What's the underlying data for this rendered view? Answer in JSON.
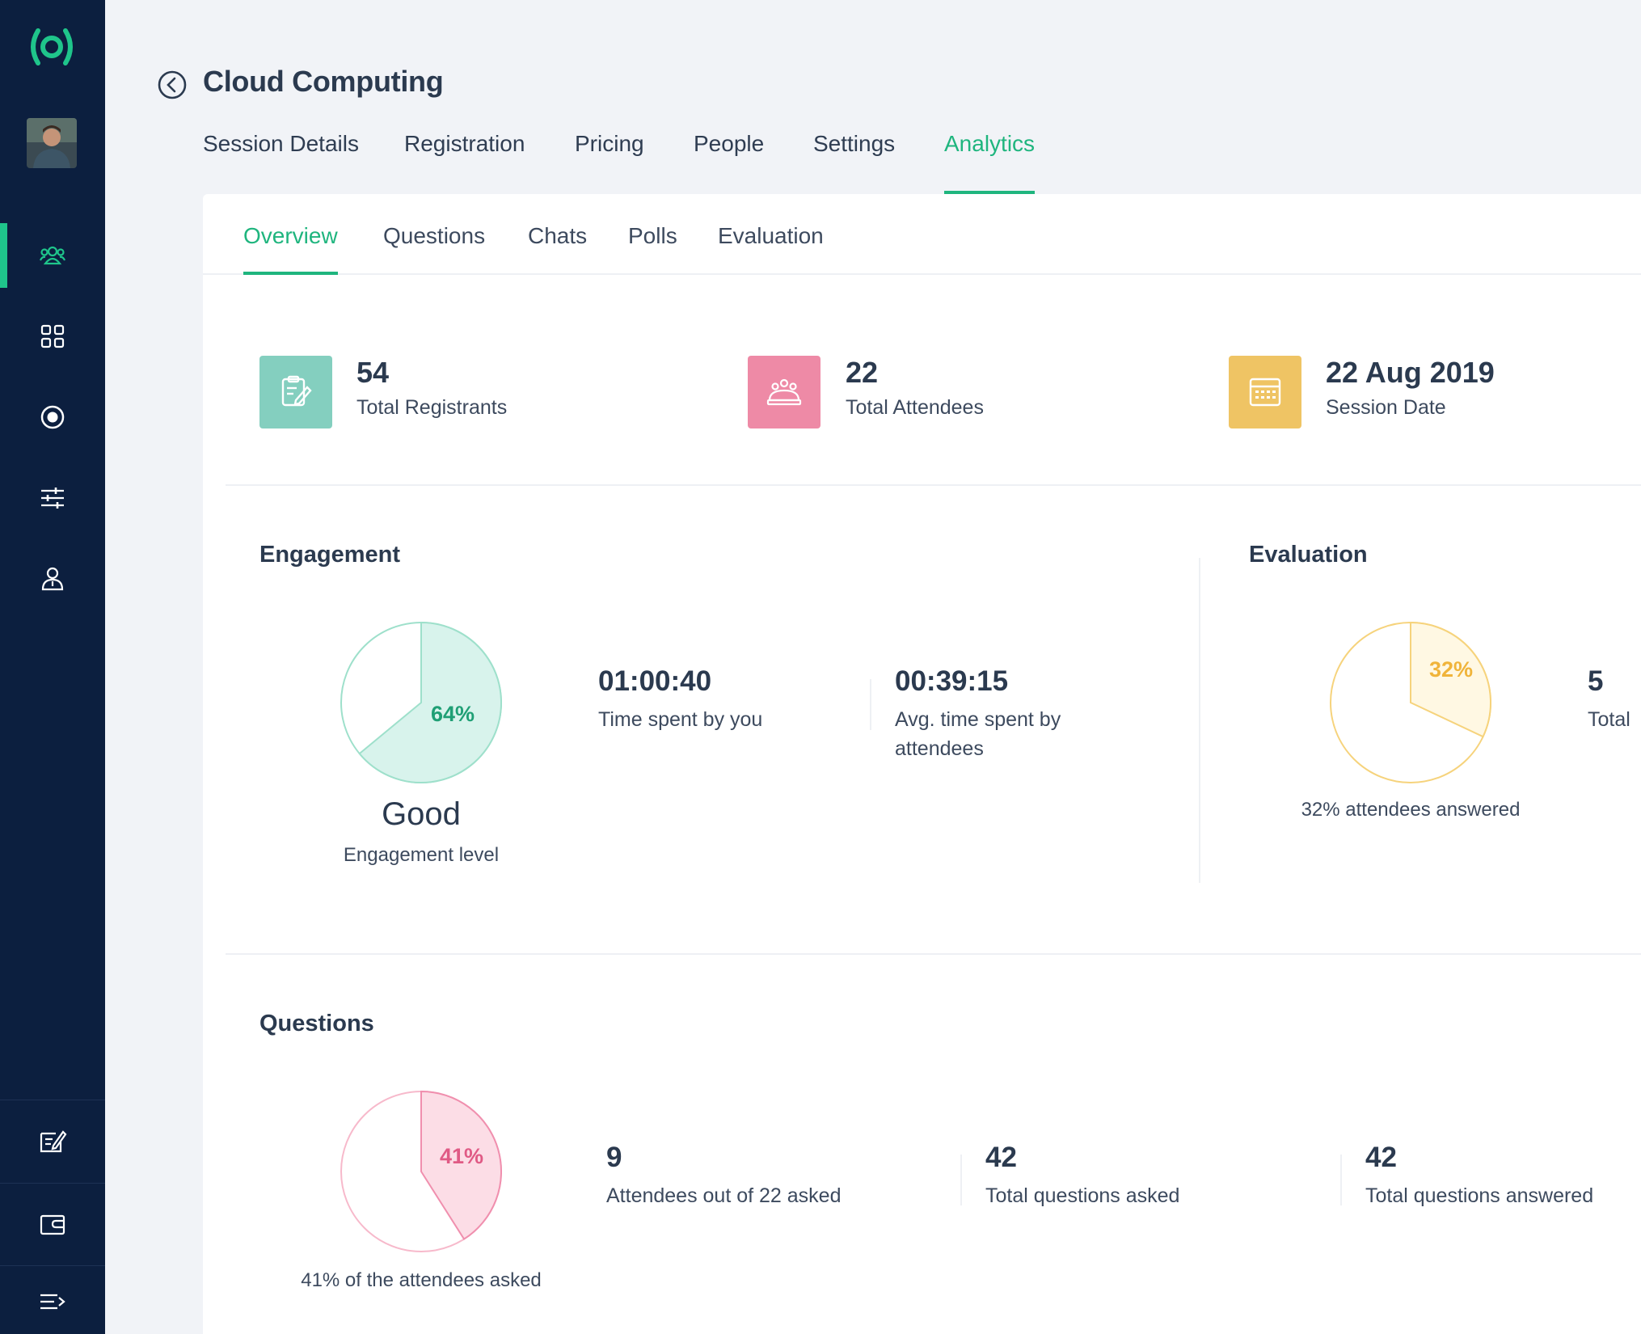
{
  "header": {
    "title": "Cloud Computing",
    "tabs": [
      "Session Details",
      "Registration",
      "Pricing",
      "People",
      "Settings",
      "Analytics"
    ],
    "active_tab": "Analytics"
  },
  "subtabs": {
    "items": [
      "Overview",
      "Questions",
      "Chats",
      "Polls",
      "Evaluation"
    ],
    "active": "Overview"
  },
  "stats": [
    {
      "value": "54",
      "label": "Total Registrants",
      "icon": "clipboard-edit-icon",
      "color": "#84cfbf"
    },
    {
      "value": "22",
      "label": "Total Attendees",
      "icon": "attendees-icon",
      "color": "#ee8aa6"
    },
    {
      "value": "22 Aug 2019",
      "label": "Session Date",
      "icon": "calendar-icon",
      "color": "#efc464"
    }
  ],
  "engagement": {
    "title": "Engagement",
    "percent": 64,
    "percent_label": "64%",
    "level": "Good",
    "level_label": "Engagement level",
    "time_you": "01:00:40",
    "time_you_label": "Time spent by you",
    "avg_time": "00:39:15",
    "avg_time_label": "Avg. time spent by attendees"
  },
  "evaluation": {
    "title": "Evaluation",
    "percent": 32,
    "percent_label": "32%",
    "caption": "32% attendees answered",
    "total_value": "5",
    "total_label": "Total"
  },
  "questions": {
    "title": "Questions",
    "percent": 41,
    "percent_label": "41%",
    "caption": "41% of the attendees asked",
    "metrics": [
      {
        "value": "9",
        "label": "Attendees out of 22 asked"
      },
      {
        "value": "42",
        "label": "Total questions asked"
      },
      {
        "value": "42",
        "label": "Total questions answered"
      }
    ]
  },
  "colors": {
    "accent": "#1fb57e",
    "sidebar": "#0c1f3f",
    "engagement_fill": "#d8f3ec",
    "engagement_stroke": "#9ee0cb",
    "evaluation_fill": "#fff8e3",
    "evaluation_stroke": "#f6d37c",
    "questions_fill": "#fcdde6",
    "questions_stroke": "#f08fae"
  },
  "sidebar_icons": [
    "people-group-icon",
    "grid-icon",
    "record-icon",
    "sliders-icon",
    "user-icon",
    "edit-list-icon",
    "wallet-icon",
    "collapse-menu-icon"
  ]
}
